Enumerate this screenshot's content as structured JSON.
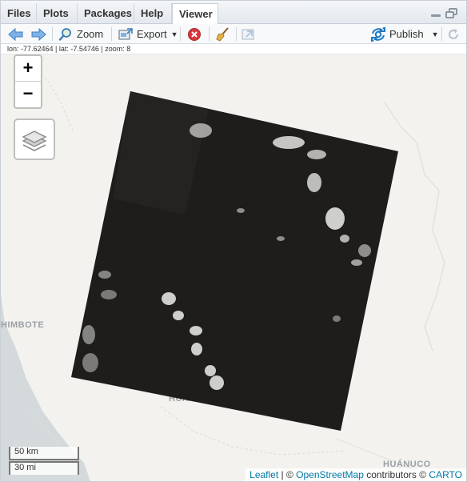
{
  "tabs": [
    {
      "label": "Files",
      "active": false
    },
    {
      "label": "Plots",
      "active": false
    },
    {
      "label": "Packages",
      "active": false
    },
    {
      "label": "Help",
      "active": false
    },
    {
      "label": "Viewer",
      "active": true
    }
  ],
  "toolbar": {
    "zoom_label": "Zoom",
    "export_label": "Export",
    "publish_label": "Publish"
  },
  "coords_text": "lon: -77.62464 | lat: -7.54746 | zoom: 8",
  "map": {
    "zoom_in": "+",
    "zoom_out": "−",
    "places": {
      "chimbote": "HIMBOTE",
      "huaraz": "HUAR",
      "huanuco": "HUÁNUCO"
    },
    "scale": {
      "km": "50 km",
      "mi": "30 mi"
    },
    "attribution": {
      "leaflet": "Leaflet",
      "sep": " | © ",
      "osm": "OpenStreetMap",
      "contrib": " contributors © ",
      "carto": "CARTO"
    }
  },
  "colors": {
    "accent": "#1f79c3",
    "link": "#0078a8",
    "imagery": "#1e1d1c"
  }
}
